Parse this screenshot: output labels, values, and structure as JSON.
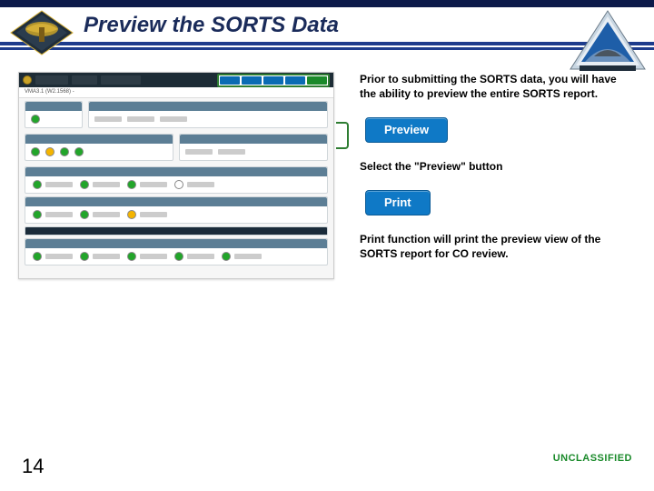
{
  "header": {
    "title": "Preview the SORTS Data"
  },
  "right": {
    "intro": "Prior to submitting the SORTS data, you will have the ability to preview the entire SORTS report.",
    "preview_button": "Preview",
    "preview_caption": "Select the \"Preview\" button",
    "print_button": "Print",
    "print_caption": "Print function will print the preview view of the SORTS report for CO review."
  },
  "screenshot": {
    "breadcrumb": "VMA3.1 (W2.1568) -"
  },
  "footer": {
    "page": "14",
    "classification": "UNCLASSIFIED"
  },
  "colors": {
    "accent": "#1e3c8c",
    "button": "#0f79c6",
    "highlight": "#2e7d32"
  }
}
